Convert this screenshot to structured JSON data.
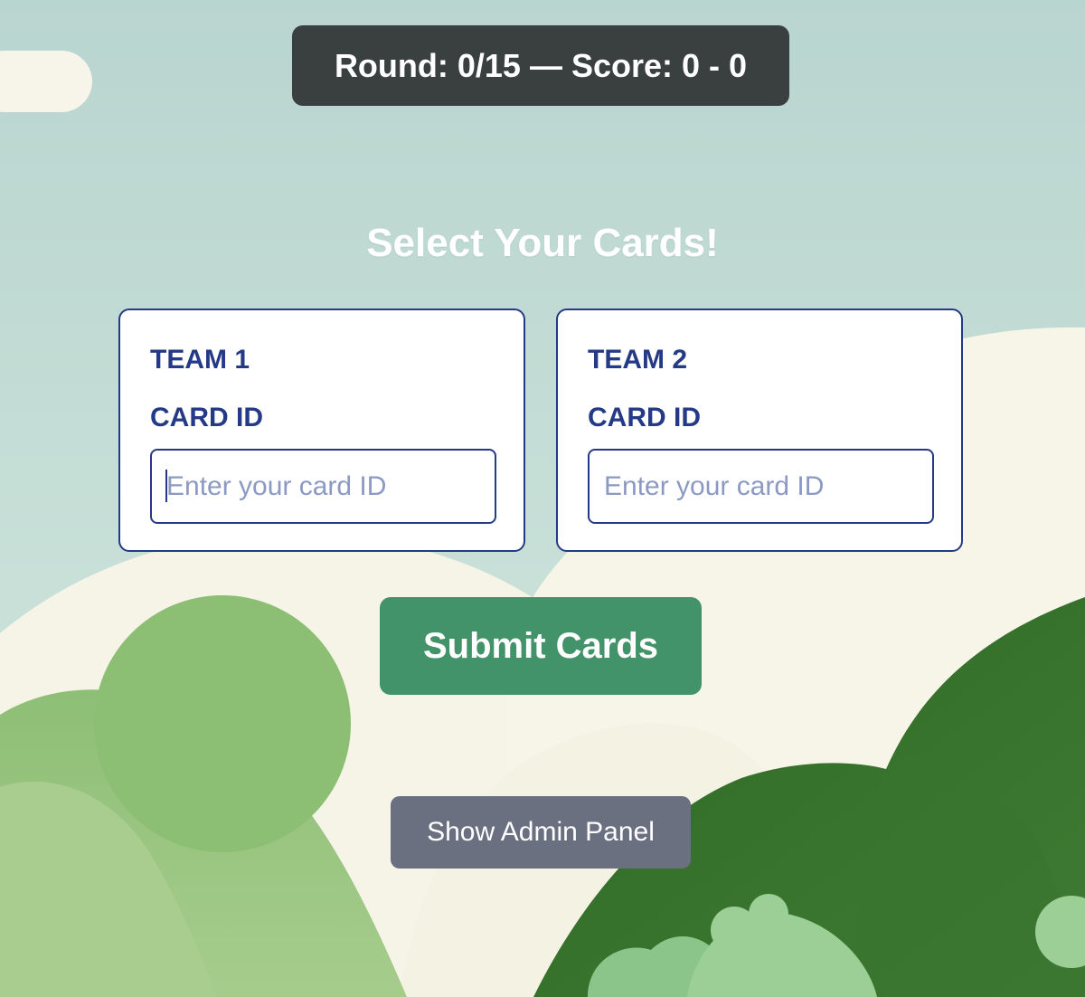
{
  "status": {
    "text": "Round: 0/15 — Score: 0 - 0"
  },
  "page": {
    "title": "Select Your Cards!"
  },
  "teams": [
    {
      "name": "TEAM 1",
      "field_label": "CARD ID",
      "input_value": "",
      "input_placeholder": "Enter your card ID"
    },
    {
      "name": "TEAM 2",
      "field_label": "CARD ID",
      "input_value": "",
      "input_placeholder": "Enter your card ID"
    }
  ],
  "actions": {
    "submit_label": "Submit Cards",
    "admin_label": "Show Admin Panel"
  },
  "colors": {
    "status_bg": "#3a403f",
    "team_accent": "#253a86",
    "submit_bg": "#43936a",
    "admin_bg": "#6b7080",
    "sky": "#c2dcd7",
    "hills": "#f6f4e6",
    "tree_light": "#8cbf73",
    "tree_dark": "#3d7830"
  }
}
